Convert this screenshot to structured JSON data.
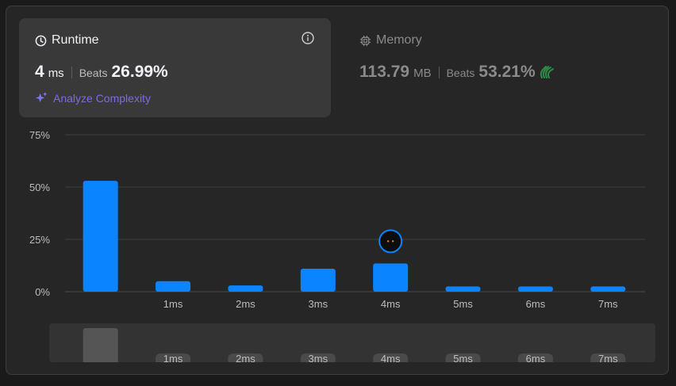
{
  "runtime": {
    "title": "Runtime",
    "value": "4",
    "unit": "ms",
    "beats_label": "Beats",
    "beats_value": "26.99%",
    "analyze_label": "Analyze Complexity"
  },
  "memory": {
    "title": "Memory",
    "value": "113.79",
    "unit": "MB",
    "beats_label": "Beats",
    "beats_value": "53.21%"
  },
  "colors": {
    "bar": "#0a84ff",
    "accent_purple": "#7b6cdf",
    "panel_bg": "#262626",
    "card_bg": "#393939"
  },
  "chart_data": {
    "type": "bar",
    "categories": [
      "",
      "1ms",
      "2ms",
      "3ms",
      "4ms",
      "5ms",
      "6ms",
      "7ms"
    ],
    "values": [
      53,
      5,
      3,
      11,
      13.5,
      2.5,
      2.5,
      2.5
    ],
    "ylim": [
      0,
      75
    ],
    "yticks": [
      "0%",
      "25%",
      "50%",
      "75%"
    ],
    "ytick_values": [
      0,
      25,
      50,
      75
    ],
    "highlight_category": "4ms",
    "grid": true
  },
  "mini_chart": {
    "labels": [
      "1ms",
      "2ms",
      "3ms",
      "4ms",
      "5ms",
      "6ms",
      "7ms"
    ]
  }
}
